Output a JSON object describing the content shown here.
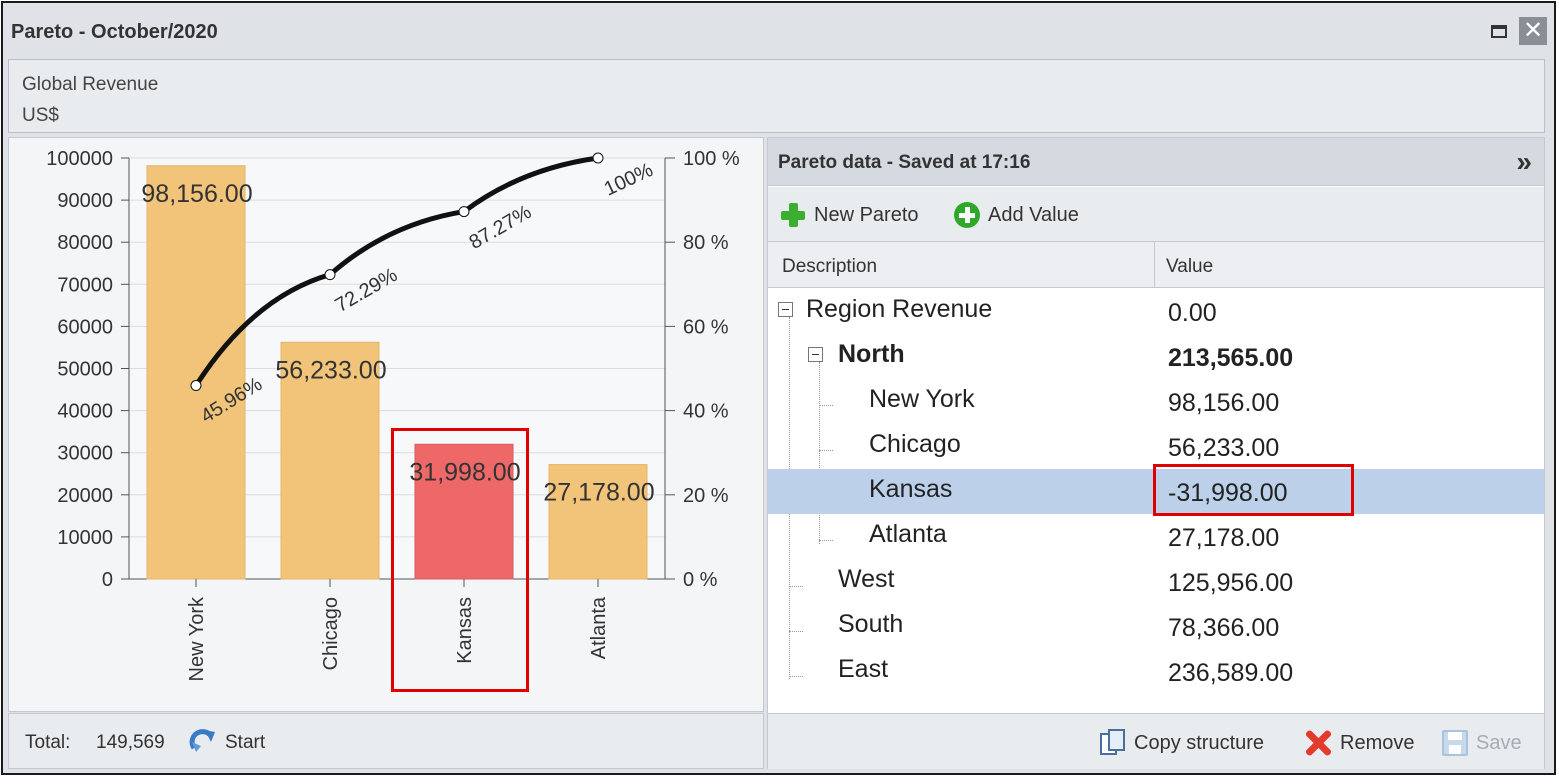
{
  "window": {
    "title": "Pareto - October/2020"
  },
  "header": {
    "line1": "Global Revenue",
    "line2": "US$"
  },
  "chart_footer": {
    "total_label": "Total:",
    "total_value": "149,569",
    "start_label": "Start"
  },
  "data_panel": {
    "title": "Pareto data - Saved at 17:16",
    "toolbar": {
      "new_pareto": "New Pareto",
      "add_value": "Add Value"
    },
    "columns": {
      "description": "Description",
      "value": "Value"
    },
    "rows": [
      {
        "label": "Region Revenue",
        "value": "0.00"
      },
      {
        "label": "North",
        "value": "213,565.00"
      },
      {
        "label": "New York",
        "value": "98,156.00"
      },
      {
        "label": "Chicago",
        "value": "56,233.00"
      },
      {
        "label": "Kansas",
        "value": "-31,998.00"
      },
      {
        "label": "Atlanta",
        "value": "27,178.00"
      },
      {
        "label": "West",
        "value": "125,956.00"
      },
      {
        "label": "South",
        "value": "78,366.00"
      },
      {
        "label": "East",
        "value": "236,589.00"
      }
    ],
    "footer": {
      "copy": "Copy structure",
      "remove": "Remove",
      "save": "Save"
    }
  },
  "colors": {
    "bar": "#f1c47a",
    "bar_highlight": "#ee6868",
    "line": "#111111",
    "selection": "#bcd0ea",
    "highlight_box": "#e10000"
  },
  "chart_data": {
    "type": "bar",
    "categories": [
      "New York",
      "Chicago",
      "Kansas",
      "Atlanta"
    ],
    "values": [
      98156,
      56233,
      31998,
      27178
    ],
    "value_labels": [
      "98,156.00",
      "56,233.00",
      "31,998.00",
      "27,178.00"
    ],
    "highlight_index": 2,
    "ylim": [
      0,
      100000
    ],
    "y_ticks": [
      "0",
      "10000",
      "20000",
      "30000",
      "40000",
      "50000",
      "60000",
      "70000",
      "80000",
      "90000",
      "100000"
    ],
    "y2_ticks": [
      "0 %",
      "20 %",
      "40 %",
      "60 %",
      "80 %",
      "100 %"
    ],
    "cumulative_percent": [
      45.96,
      72.29,
      87.27,
      100
    ],
    "cumulative_labels": [
      "45.96%",
      "72.29%",
      "87.27%",
      "100%"
    ],
    "grid": true
  }
}
